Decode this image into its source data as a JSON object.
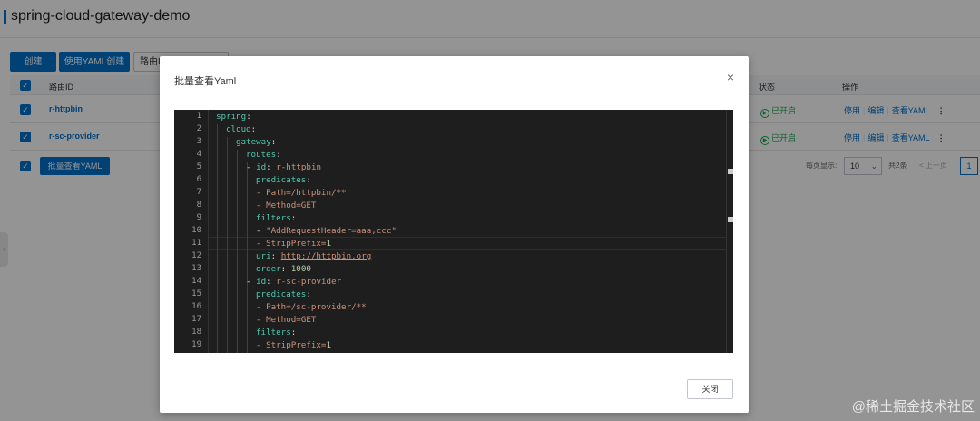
{
  "page": {
    "title": "spring-cloud-gateway-demo",
    "toolbar": {
      "create_label": "创建",
      "yaml_create_label": "使用YAML创建",
      "route_tab_label": "路由I"
    },
    "table": {
      "headers": {
        "id": "路由ID",
        "status": "状态",
        "actions": "操作"
      },
      "rows": [
        {
          "id": "r-httpbin",
          "status": "已开启"
        },
        {
          "id": "r-sc-provider",
          "status": "已开启"
        }
      ],
      "actions": {
        "disable": "停用",
        "edit": "编辑",
        "view_yaml": "查看YAML",
        "more": "⋮"
      },
      "check_mark": "✓"
    },
    "footer": {
      "batch_button": "批量查看YAML",
      "page_size_label": "每页显示:",
      "page_size_value": "10",
      "total_label": "共2条",
      "prev_label": "< 上一页",
      "current_page": "1"
    },
    "side_handle_icon": "‹"
  },
  "modal": {
    "title": "批量查看Yaml",
    "close_icon": "×",
    "close_button": "关闭",
    "line_numbers": [
      "1",
      "2",
      "3",
      "4",
      "5",
      "6",
      "7",
      "8",
      "9",
      "10",
      "11",
      "12",
      "13",
      "14",
      "15",
      "16",
      "17",
      "18",
      "19"
    ],
    "code": {
      "l1_key": "spring",
      "l1_p": ":",
      "l2_key": "cloud",
      "l2_p": ":",
      "l3_key": "gateway",
      "l3_p": ":",
      "l4_key": "routes",
      "l4_p": ":",
      "l5_dash": "- ",
      "l5_key": "id",
      "l5_p": ": ",
      "l5_val": "r-httpbin",
      "l6_key": "predicates",
      "l6_p": ":",
      "l7_val": "- Path=/httpbin/**",
      "l8_val": "- Method=GET",
      "l9_key": "filters",
      "l9_p": ":",
      "l10_dash": "- ",
      "l10_val": "\"AddRequestHeader=aaa,ccc\"",
      "l11_val": "- StripPrefix=",
      "l11_num": "1",
      "l12_key": "uri",
      "l12_p": ": ",
      "l12_val": "http://httpbin.org",
      "l13_key": "order",
      "l13_p": ": ",
      "l13_num": "1000",
      "l14_dash": "- ",
      "l14_key": "id",
      "l14_p": ": ",
      "l14_val": "r-sc-provider",
      "l15_key": "predicates",
      "l15_p": ":",
      "l16_val": "- Path=/sc-provider/**",
      "l17_val": "- Method=GET",
      "l18_key": "filters",
      "l18_p": ":",
      "l19_val": "- StripPrefix=",
      "l19_num": "1"
    }
  },
  "watermark": "@稀土掘金技术社区"
}
